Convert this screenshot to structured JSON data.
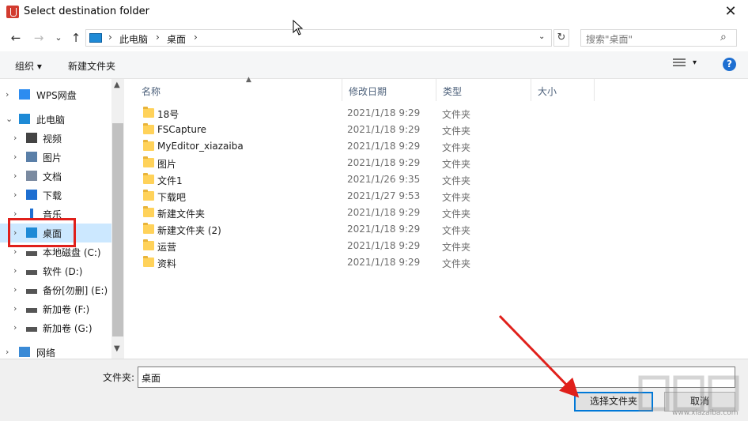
{
  "window": {
    "title": "Select destination folder",
    "close": "✕"
  },
  "nav": {
    "back": "←",
    "forward": "→",
    "recent": "⌄",
    "up": "↑",
    "breadcrumb": [
      "此电脑",
      "桌面"
    ],
    "separator": "›",
    "dropdown": "⌄",
    "refresh": "↻",
    "search_placeholder": "搜索\"桌面\"",
    "search_icon": "⌕"
  },
  "toolbar": {
    "organize": "组织 ▾",
    "new_folder": "新建文件夹",
    "view_dropdown": "▾",
    "help": "?"
  },
  "tree": [
    {
      "label": "WPS网盘",
      "icon": "cloud-icon",
      "chev": ">",
      "indent": 0
    },
    {
      "label": "此电脑",
      "icon": "computer-icon",
      "chev": "v",
      "indent": 0
    },
    {
      "label": "视频",
      "icon": "video-icon",
      "chev": ">",
      "indent": 1
    },
    {
      "label": "图片",
      "icon": "pictures-icon",
      "chev": ">",
      "indent": 1
    },
    {
      "label": "文档",
      "icon": "documents-icon",
      "chev": ">",
      "indent": 1
    },
    {
      "label": "下载",
      "icon": "download-icon",
      "chev": ">",
      "indent": 1
    },
    {
      "label": "音乐",
      "icon": "music-icon",
      "chev": ">",
      "indent": 1
    },
    {
      "label": "桌面",
      "icon": "desktop-icon",
      "chev": ">",
      "indent": 1,
      "selected": true
    },
    {
      "label": "本地磁盘 (C:)",
      "icon": "drive-icon",
      "chev": ">",
      "indent": 1
    },
    {
      "label": "软件 (D:)",
      "icon": "drive-icon",
      "chev": ">",
      "indent": 1
    },
    {
      "label": "备份[勿删] (E:)",
      "icon": "drive-icon",
      "chev": ">",
      "indent": 1
    },
    {
      "label": "新加卷 (F:)",
      "icon": "drive-icon",
      "chev": ">",
      "indent": 1
    },
    {
      "label": "新加卷 (G:)",
      "icon": "drive-icon",
      "chev": ">",
      "indent": 1
    },
    {
      "label": "网络",
      "icon": "network-icon",
      "chev": ">",
      "indent": 0
    }
  ],
  "columns": [
    "名称",
    "修改日期",
    "类型",
    "大小"
  ],
  "files": [
    {
      "name": "18号",
      "date": "2021/1/18 9:29",
      "type": "文件夹"
    },
    {
      "name": "FSCapture",
      "date": "2021/1/18 9:29",
      "type": "文件夹"
    },
    {
      "name": "MyEditor_xiazaiba",
      "date": "2021/1/18 9:29",
      "type": "文件夹"
    },
    {
      "name": "图片",
      "date": "2021/1/18 9:29",
      "type": "文件夹"
    },
    {
      "name": "文件1",
      "date": "2021/1/26 9:35",
      "type": "文件夹"
    },
    {
      "name": "下载吧",
      "date": "2021/1/27 9:53",
      "type": "文件夹"
    },
    {
      "name": "新建文件夹",
      "date": "2021/1/18 9:29",
      "type": "文件夹"
    },
    {
      "name": "新建文件夹 (2)",
      "date": "2021/1/18 9:29",
      "type": "文件夹"
    },
    {
      "name": "运营",
      "date": "2021/1/18 9:29",
      "type": "文件夹"
    },
    {
      "name": "资料",
      "date": "2021/1/18 9:29",
      "type": "文件夹"
    }
  ],
  "footer": {
    "folder_label": "文件夹:",
    "folder_value": "桌面",
    "select_button": "选择文件夹",
    "cancel_button": "取消"
  },
  "watermark": {
    "site": "www.xiazaiba.com"
  },
  "colors": {
    "accent": "#0078d7",
    "annotation": "#e0201b",
    "selected": "#cce8ff"
  }
}
